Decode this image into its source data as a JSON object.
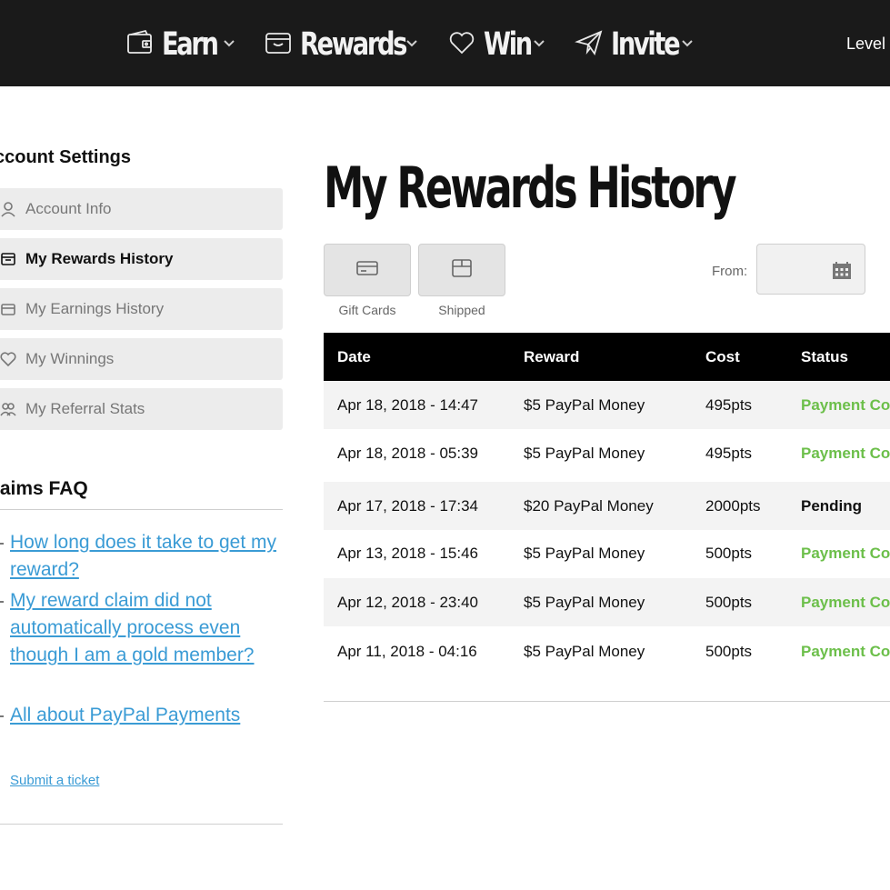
{
  "nav": {
    "items": [
      {
        "label": "Earn",
        "icon": "wallet-icon"
      },
      {
        "label": "Rewards",
        "icon": "box-icon"
      },
      {
        "label": "Win",
        "icon": "heart-icon"
      },
      {
        "label": "Invite",
        "icon": "paper-plane-icon"
      }
    ],
    "level_label": "Level"
  },
  "sidebar": {
    "title": "ccount Settings",
    "items": [
      {
        "label": "Account Info",
        "icon": "user-icon",
        "active": false
      },
      {
        "label": "My Rewards History",
        "icon": "rewards-icon",
        "active": true
      },
      {
        "label": "My Earnings History",
        "icon": "earnings-icon",
        "active": false
      },
      {
        "label": "My Winnings",
        "icon": "heart-icon",
        "active": false
      },
      {
        "label": "My Referral Stats",
        "icon": "users-icon",
        "active": false
      }
    ],
    "faq_title": "laims FAQ",
    "faq_links": [
      "How long does it take to get my reward?",
      "My reward claim did not automatically process even though I am a gold member?",
      "All about PayPal Payments"
    ],
    "ticket_link": "Submit a ticket"
  },
  "main": {
    "title": "My Rewards History",
    "filters": [
      {
        "label": "Gift Cards",
        "icon": "card-icon"
      },
      {
        "label": "Shipped",
        "icon": "package-icon"
      }
    ],
    "from_label": "From:",
    "date_value": ""
  },
  "table": {
    "columns": [
      "Date",
      "Reward",
      "Cost",
      "Status"
    ],
    "rows": [
      {
        "date": "Apr 18, 2018 - 14:47",
        "reward": "$5 PayPal Money",
        "cost": "495pts",
        "status": "Payment Co"
      },
      {
        "date": "Apr 18, 2018 - 05:39",
        "reward": "$5 PayPal Money",
        "cost": "495pts",
        "status": "Payment Co"
      },
      {
        "date": "Apr 17, 2018 - 17:34",
        "reward": "$20 PayPal Money",
        "cost": "2000pts",
        "status": "Pending"
      },
      {
        "date": "Apr 13, 2018 - 15:46",
        "reward": "$5 PayPal Money",
        "cost": "500pts",
        "status": "Payment Co"
      },
      {
        "date": "Apr 12, 2018 - 23:40",
        "reward": "$5 PayPal Money",
        "cost": "500pts",
        "status": "Payment Co"
      },
      {
        "date": "Apr 11, 2018 - 04:16",
        "reward": "$5 PayPal Money",
        "cost": "500pts",
        "status": "Payment Co"
      }
    ]
  },
  "colors": {
    "topbar": "#1a1a1a",
    "link": "#3a9bd5",
    "status_complete": "#6cbf4a",
    "status_pending": "#111111",
    "row_shade": "#f3f3f3"
  }
}
